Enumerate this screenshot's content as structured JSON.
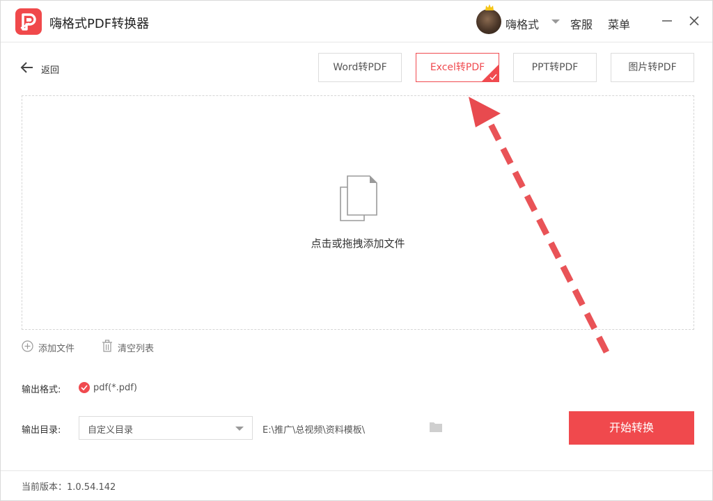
{
  "app": {
    "title": "嗨格式PDF转换器",
    "accent_color": "#f04a4f",
    "logo_icon": "app-logo-icon"
  },
  "header": {
    "username": "嗨格式",
    "service_label": "客服",
    "menu_label": "菜单"
  },
  "nav": {
    "back_label": "返回"
  },
  "tabs": [
    {
      "label": "Word转PDF",
      "active": false
    },
    {
      "label": "Excel转PDF",
      "active": true
    },
    {
      "label": "PPT转PDF",
      "active": false
    },
    {
      "label": "图片转PDF",
      "active": false
    }
  ],
  "dropzone": {
    "hint": "点击或拖拽添加文件"
  },
  "actions": {
    "add_file": "添加文件",
    "clear_list": "清空列表"
  },
  "output": {
    "format_label": "输出格式:",
    "format_value": "pdf(*.pdf)",
    "dir_label": "输出目录:",
    "dir_option": "自定义目录",
    "dir_path": "E:\\推广\\总视频\\资料模板\\"
  },
  "start_button": "开始转换",
  "footer": {
    "version": "当前版本：1.0.54.142"
  }
}
